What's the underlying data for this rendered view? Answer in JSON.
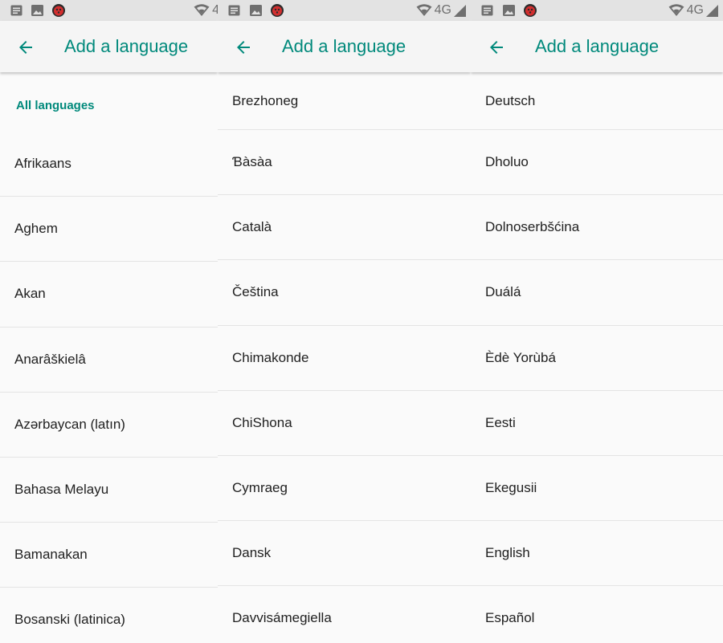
{
  "colors": {
    "accent": "#00897b",
    "text": "#212121",
    "status_bar": "#e3e3e3",
    "icon_gray": "#6f6f6f"
  },
  "status_bar": {
    "notification_icons": [
      "notes-icon",
      "image-icon",
      "bug-icon"
    ],
    "network_label": "4G",
    "network_label_truncated": "4"
  },
  "screen1": {
    "title": "Add a language",
    "section_label": "All languages",
    "languages": [
      "Afrikaans",
      "Aghem",
      "Akan",
      "Anarâškielâ",
      "Azərbaycan (latın)",
      "Bahasa Melayu",
      "Bamanakan",
      "Bosanski (latinica)"
    ]
  },
  "screen2": {
    "title": "Add a language",
    "languages": [
      "Brezhoneg",
      "Ɓàsàa",
      "Català",
      "Čeština",
      "Chimakonde",
      "ChiShona",
      "Cymraeg",
      "Dansk",
      "Davvisámegiella"
    ]
  },
  "screen3": {
    "title": "Add a language",
    "languages": [
      "Deutsch",
      "Dholuo",
      "Dolnoserbšćina",
      "Duálá",
      "Èdè Yorùbá",
      "Eesti",
      "Ekegusii",
      "English",
      "Español"
    ]
  }
}
